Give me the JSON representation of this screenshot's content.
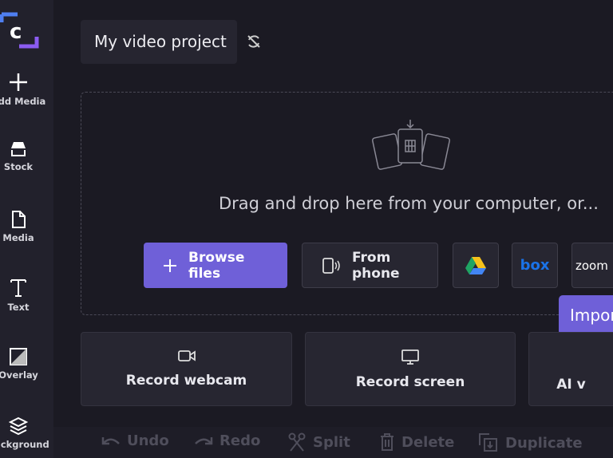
{
  "app": {
    "logo_letter": "c",
    "project_title": "My video project"
  },
  "sidebar": {
    "items": [
      {
        "label": "Add Media",
        "icon": "plus-icon"
      },
      {
        "label": "Stock",
        "icon": "stock-icon"
      },
      {
        "label": "Media",
        "icon": "file-icon"
      },
      {
        "label": "Text",
        "icon": "text-icon"
      },
      {
        "label": "Overlay",
        "icon": "overlay-icon"
      },
      {
        "label": "Background",
        "icon": "layers-icon"
      }
    ]
  },
  "dropzone": {
    "text": "Drag and drop here from your computer, or..."
  },
  "sources": {
    "browse": "Browse files",
    "browse_l1": "Browse",
    "browse_l2": "files",
    "phone_l1": "From",
    "phone_l2": "phone",
    "drive": "google-drive-icon",
    "box": "box",
    "zoom": "zoom"
  },
  "tooltip": "Import",
  "cards": [
    {
      "label": "Record webcam"
    },
    {
      "label": "Record screen"
    },
    {
      "label": "AI v"
    }
  ],
  "toolbar": {
    "undo": "Undo",
    "redo": "Redo",
    "split": "Split",
    "delete": "Delete",
    "duplicate": "Duplicate"
  },
  "colors": {
    "accent": "#6f60d8",
    "background": "#1b1a23",
    "sidebar": "#22212c"
  }
}
